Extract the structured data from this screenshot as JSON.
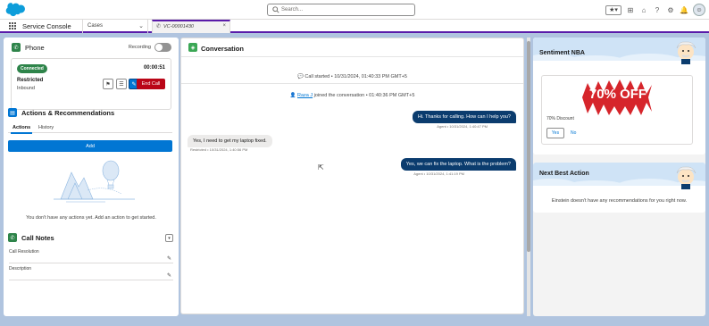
{
  "header": {
    "search_placeholder": "Search...",
    "favorites_icon": "star-icon",
    "icons": [
      "add-icon",
      "trailhead-icon",
      "help-icon",
      "gear-icon",
      "bell-icon"
    ]
  },
  "nav": {
    "app_name": "Service Console",
    "object_selector": "Cases",
    "tab_label": "VC-00001430"
  },
  "phone": {
    "title": "Phone",
    "recording_label": "Recording",
    "status_badge": "Connected",
    "timer": "00:00:51",
    "caller_name": "Restricted",
    "direction": "Inbound",
    "end_call_label": "End Call"
  },
  "actions": {
    "title": "Actions & Recommendations",
    "tabs": [
      "Actions",
      "History"
    ],
    "add_label": "Add",
    "empty_text": "You don't have any actions yet. Add an action to get started."
  },
  "call_notes": {
    "title": "Call Notes",
    "fields": [
      "Call Resolution",
      "Description"
    ]
  },
  "conversation": {
    "title": "Conversation",
    "call_started": "Call started • 10/31/2024, 01:40:33 PM GMT+5",
    "joined_name": "Raza J",
    "joined_text": " joined the conversation • 01:40:36 PM GMT+5",
    "messages": [
      {
        "from": "agent",
        "text": "Hi. Thanks for calling. How can I help you?",
        "meta": "Agent • 10/31/2024, 1:40:47 PM"
      },
      {
        "from": "customer",
        "text": "Yes, I need to get my laptop fixed.",
        "meta": "Restricted • 10/31/2024, 1:40:56 PM"
      },
      {
        "from": "agent",
        "text": "Yes, we can fix the laptop. What is the problem?",
        "meta": "Agent • 10/31/2024, 1:41:19 PM"
      }
    ]
  },
  "sentiment_nba": {
    "title": "Sentiment NBA",
    "promo_caption": "70% Discount",
    "promo_image_text": "70% OFF",
    "yes_label": "Yes",
    "no_label": "No"
  },
  "next_best_action": {
    "title": "Next Best Action",
    "empty_text": "Einstein doesn't have any recommendations for you right now."
  },
  "colors": {
    "brand_blue": "#0176d3",
    "agent_bubble": "#0b3c6e",
    "end_call_red": "#ba0517",
    "connected_green": "#2e844a",
    "tab_accent": "#5a1ba9"
  }
}
